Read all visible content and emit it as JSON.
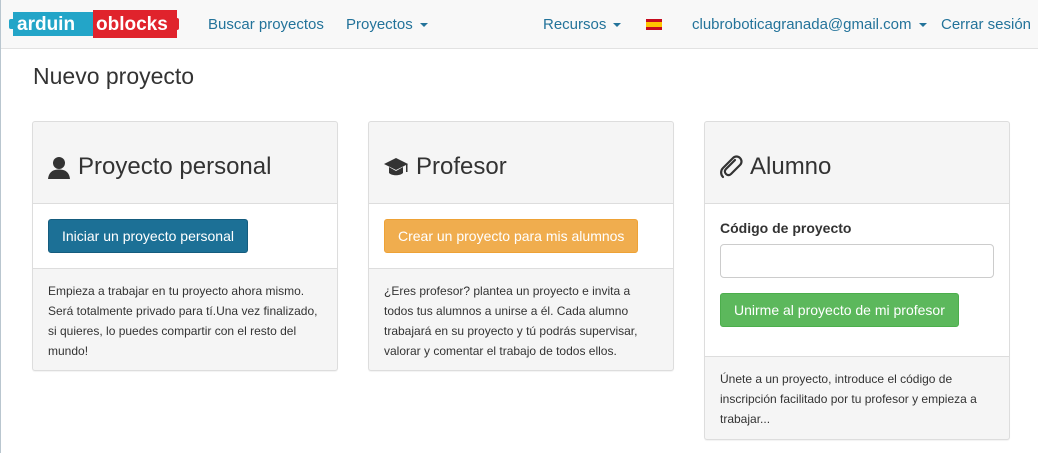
{
  "brand": {
    "logo_text_left": "arduin",
    "logo_text_right": "oblocks",
    "colors": {
      "blue": "#23a5c8",
      "red": "#e0232c"
    }
  },
  "nav": {
    "search": "Buscar proyectos",
    "projects": "Proyectos",
    "resources": "Recursos",
    "language_flag": "flag-es-icon",
    "user_email": "clubroboticagranada@gmail.com",
    "logout": "Cerrar sesión"
  },
  "page": {
    "title": "Nuevo proyecto"
  },
  "panels": [
    {
      "icon": "user-icon",
      "title": "Proyecto personal",
      "button": "Iniciar un proyecto personal",
      "description": "Empieza a trabajar en tu proyecto ahora mismo. Será totalmente privado para tí.Una vez finalizado, si quieres, lo puedes compartir con el resto del mundo!"
    },
    {
      "icon": "graduation-cap-icon",
      "title": "Profesor",
      "button": "Crear un proyecto para mis alumnos",
      "description": "¿Eres profesor? plantea un proyecto e invita a todos tus alumnos a unirse a él. Cada alumno trabajará en su proyecto y tú podrás supervisar, valorar y comentar el trabajo de todos ellos."
    },
    {
      "icon": "paperclip-icon",
      "title": "Alumno",
      "code_label": "Código de proyecto",
      "code_value": "",
      "code_placeholder": "",
      "button": "Unirme al proyecto de mi profesor",
      "description": "Únete a un proyecto, introduce el código de inscripción facilitado por tu profesor y empieza a trabajar..."
    }
  ]
}
